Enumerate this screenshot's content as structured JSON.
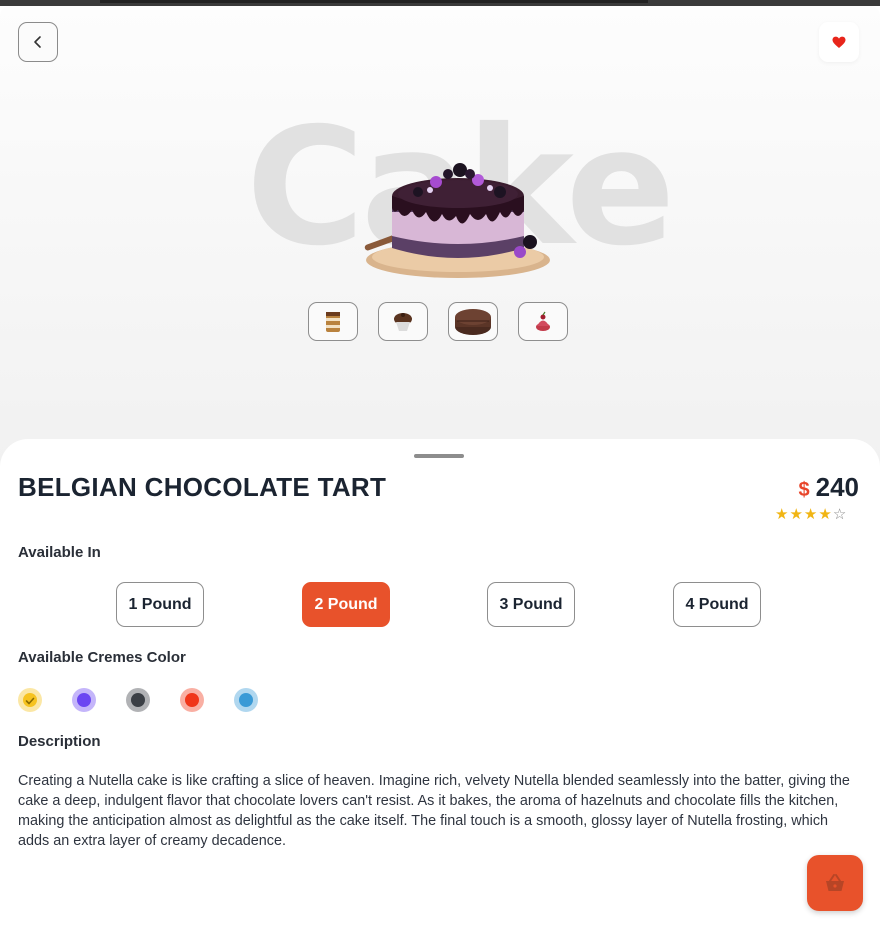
{
  "colors": {
    "accent": "#e8522b",
    "price_currency": "#e8452a",
    "heart": "#e8251b",
    "star_on": "#f1b514",
    "text_dark": "#1b2431"
  },
  "hero": {
    "watermark": "Cake",
    "back_icon": "chevron-left-icon",
    "favorite_icon": "heart-icon",
    "thumbnails": [
      {
        "name": "thumb-cake-slice"
      },
      {
        "name": "thumb-cupcake"
      },
      {
        "name": "thumb-chocolate-cake"
      },
      {
        "name": "thumb-berry-dessert"
      }
    ]
  },
  "product": {
    "title": "BELGIAN CHOCOLATE TART",
    "currency": "$",
    "price": "240",
    "rating": 4,
    "rating_max": 5,
    "available_in_label": "Available In",
    "sizes": [
      {
        "label": "1 Pound",
        "selected": false
      },
      {
        "label": "2 Pound",
        "selected": true
      },
      {
        "label": "3 Pound",
        "selected": false
      },
      {
        "label": "4 Pound",
        "selected": false
      }
    ],
    "cremes_label": "Available Cremes Color",
    "cremes_colors": [
      {
        "color": "#f6c31f",
        "selected": true
      },
      {
        "color": "#6b46f2",
        "selected": false
      },
      {
        "color": "#3b3f45",
        "selected": false
      },
      {
        "color": "#f0361a",
        "selected": false
      },
      {
        "color": "#3a9ad6",
        "selected": false
      }
    ],
    "description_label": "Description",
    "description": "Creating a Nutella cake is like crafting a slice of heaven. Imagine rich, velvety Nutella blended seamlessly into the batter, giving the cake a deep, indulgent flavor that chocolate lovers can't resist. As it bakes, the aroma of hazelnuts and chocolate fills the kitchen, making the anticipation almost as delightful as the cake itself. The final touch is a smooth, glossy layer of Nutella frosting, which adds an extra layer of creamy decadence."
  },
  "cart": {
    "icon": "shopping-basket-icon"
  }
}
